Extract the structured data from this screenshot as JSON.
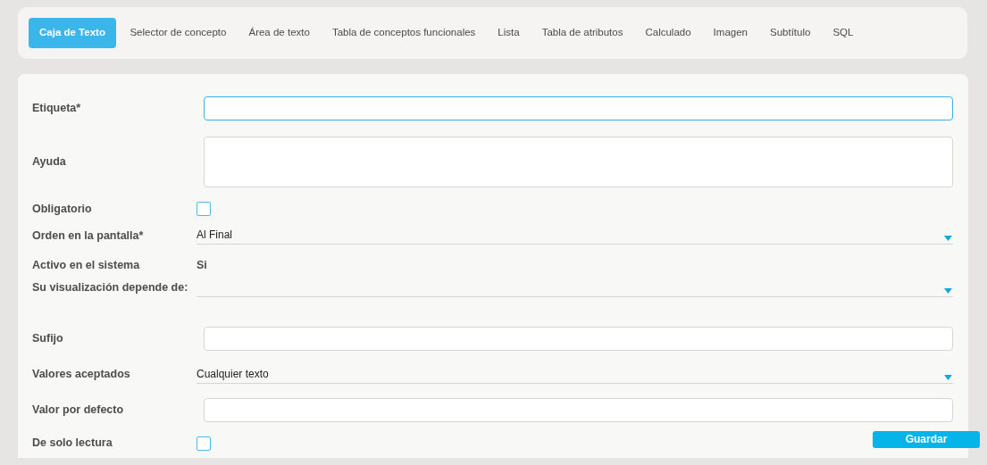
{
  "tabs": [
    {
      "label": "Caja de Texto",
      "selected": true
    },
    {
      "label": "Selector de concepto",
      "selected": false
    },
    {
      "label": "Área de texto",
      "selected": false
    },
    {
      "label": "Tabla de conceptos funcionales",
      "selected": false
    },
    {
      "label": "Lista",
      "selected": false
    },
    {
      "label": "Tabla de atributos",
      "selected": false
    },
    {
      "label": "Calculado",
      "selected": false
    },
    {
      "label": "Imagen",
      "selected": false
    },
    {
      "label": "Subtítulo",
      "selected": false
    },
    {
      "label": "SQL",
      "selected": false
    }
  ],
  "fields": [
    {
      "kind": "text",
      "label": "Etiqueta*",
      "focused": true
    },
    {
      "kind": "textarea",
      "label": "Ayuda"
    },
    {
      "kind": "checkbox",
      "label": "Obligatorio",
      "checked": false
    },
    {
      "kind": "select",
      "label": "Orden en la pantalla*",
      "value": "Al Final"
    },
    {
      "kind": "static",
      "label": "Activo en el sistema",
      "value": "Si"
    },
    {
      "kind": "select",
      "label": "Su visualización depende de:"
    },
    {
      "kind": "text",
      "label": "Sufijo",
      "focused": false
    },
    {
      "kind": "select",
      "label": "Valores aceptados",
      "value": "Cualquier texto"
    },
    {
      "kind": "text",
      "label": "Valor por defecto",
      "focused": false
    },
    {
      "kind": "checkbox",
      "label": "De solo lectura",
      "checked": false
    }
  ],
  "save_button": "Guardar"
}
